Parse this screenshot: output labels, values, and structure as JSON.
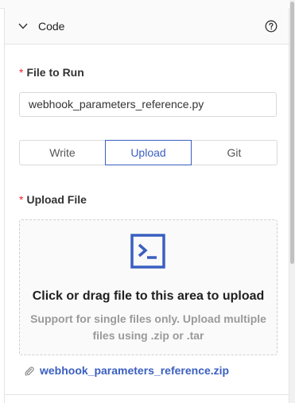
{
  "section": {
    "title": "Code",
    "icons": {
      "collapse": "chevron-down-icon",
      "help": "question-circle-icon"
    }
  },
  "file_to_run": {
    "label": "File to Run",
    "required_mark": "*",
    "value": "webhook_parameters_reference.py"
  },
  "mode_tabs": {
    "options": [
      "Write",
      "Upload",
      "Git"
    ],
    "selected": "Upload"
  },
  "upload": {
    "label": "Upload File",
    "required_mark": "*",
    "dropzone_title": "Click or drag file to this area to upload",
    "dropzone_hint": "Support for single files only. Upload multiple files using .zip or .tar",
    "icon": "terminal-icon",
    "uploaded_file": "webhook_parameters_reference.zip",
    "file_icon": "paperclip-icon"
  },
  "colors": {
    "accent": "#3b5fc0",
    "required": "#f5222d",
    "border": "#d9d9d9"
  }
}
